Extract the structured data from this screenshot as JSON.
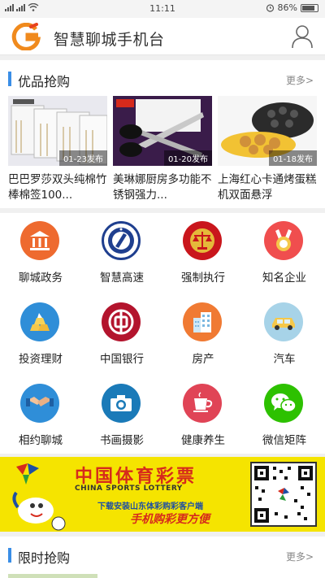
{
  "status": {
    "time": "11:11",
    "battery": "86%"
  },
  "header": {
    "title": "智慧聊城手机台"
  },
  "flash_sale": {
    "title": "优品抢购",
    "more": "更多>",
    "items": [
      {
        "name": "巴巴罗莎双头纯棉竹棒棉签100...",
        "date": "01-23发布"
      },
      {
        "name": "美琳娜厨房多功能不锈钢强力...",
        "date": "01-20发布"
      },
      {
        "name": "上海红心卡通烤蛋糕机双面悬浮",
        "date": "01-18发布"
      }
    ]
  },
  "grid": [
    {
      "label": "聊城政务",
      "icon": "government-building-icon",
      "color": "#ee6a2f"
    },
    {
      "label": "智慧高速",
      "icon": "highway-emblem-icon",
      "color": "#1f3f8f"
    },
    {
      "label": "强制执行",
      "icon": "court-scales-icon",
      "color": "#c9161c"
    },
    {
      "label": "知名企业",
      "icon": "award-medal-icon",
      "color": "#f04e4e"
    },
    {
      "label": "投资理财",
      "icon": "gold-bars-icon",
      "color": "#2f8ed8"
    },
    {
      "label": "中国银行",
      "icon": "bank-of-china-icon",
      "color": "#b3142d"
    },
    {
      "label": "房产",
      "icon": "building-icon",
      "color": "#f07a33"
    },
    {
      "label": "汽车",
      "icon": "car-icon",
      "color": "#a7d3e8"
    },
    {
      "label": "相约聊城",
      "icon": "handshake-icon",
      "color": "#2f8ed8"
    },
    {
      "label": "书画摄影",
      "icon": "camera-icon",
      "color": "#1a7ab8"
    },
    {
      "label": "健康养生",
      "icon": "tea-cup-icon",
      "color": "#e04456"
    },
    {
      "label": "微信矩阵",
      "icon": "wechat-icon",
      "color": "#2dc100"
    }
  ],
  "banner": {
    "title": "中国体育彩票",
    "subtitle": "CHINA SPORTS LOTTERY",
    "line2": "下载安装山东体彩购彩客户端",
    "line3": "手机购彩更方便"
  },
  "limited_sale": {
    "title": "限时抢购",
    "more": "更多>"
  }
}
